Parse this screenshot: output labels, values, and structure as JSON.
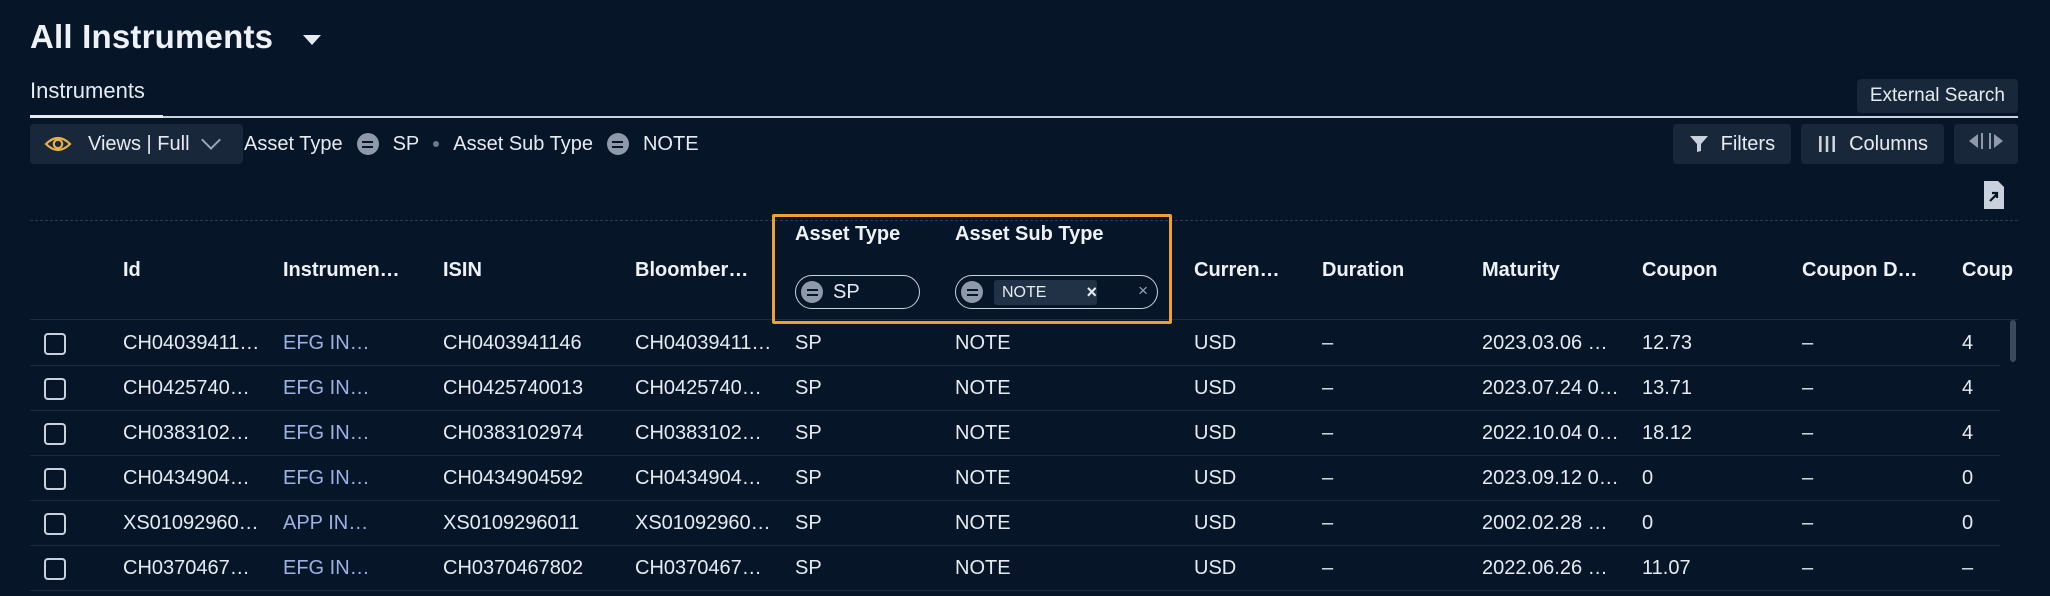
{
  "header": {
    "title": "All Instruments"
  },
  "tabs": [
    {
      "label": "Instruments",
      "active": true
    }
  ],
  "external_search_label": "External Search",
  "toolbar": {
    "views_label": "Views | Full",
    "filter_summary": [
      {
        "field": "Asset Type",
        "operator": "equals",
        "value": "SP"
      },
      {
        "field": "Asset Sub Type",
        "operator": "equals",
        "value": "NOTE"
      }
    ],
    "filters_label": "Filters",
    "columns_label": "Columns"
  },
  "grid": {
    "columns": [
      "Id",
      "Instrumen…",
      "ISIN",
      "Bloomber…",
      "Asset Type",
      "Asset Sub Type",
      "Curren…",
      "Duration",
      "Maturity",
      "Coupon",
      "Coupon D…",
      "Coup"
    ],
    "column_filters": {
      "asset_type": "SP",
      "asset_sub_type": "NOTE"
    },
    "rows": [
      [
        "CH04039411…",
        "EFG IN…",
        "CH0403941146",
        "CH04039411…",
        "SP",
        "NOTE",
        "USD",
        "–",
        "2023.03.06 …",
        "12.73",
        "–",
        "4"
      ],
      [
        "CH0425740…",
        "EFG IN…",
        "CH0425740013",
        "CH0425740…",
        "SP",
        "NOTE",
        "USD",
        "–",
        "2023.07.24 0…",
        "13.71",
        "–",
        "4"
      ],
      [
        "CH0383102…",
        "EFG IN…",
        "CH0383102974",
        "CH0383102…",
        "SP",
        "NOTE",
        "USD",
        "–",
        "2022.10.04 0…",
        "18.12",
        "–",
        "4"
      ],
      [
        "CH0434904…",
        "EFG IN…",
        "CH0434904592",
        "CH0434904…",
        "SP",
        "NOTE",
        "USD",
        "–",
        "2023.09.12 0…",
        "0",
        "–",
        "0"
      ],
      [
        "XS01092960…",
        "APP IN…",
        "XS0109296011",
        "XS01092960…",
        "SP",
        "NOTE",
        "USD",
        "–",
        "2002.02.28 …",
        "0",
        "–",
        "0"
      ],
      [
        "CH0370467…",
        "EFG IN…",
        "CH0370467802",
        "CH0370467…",
        "SP",
        "NOTE",
        "USD",
        "–",
        "2022.06.26 …",
        "11.07",
        "–",
        "–"
      ]
    ]
  },
  "colors": {
    "background": "#061628",
    "highlight": "#f0a02e",
    "link": "#9fb0e4",
    "eye_icon": "#e6b04a"
  }
}
